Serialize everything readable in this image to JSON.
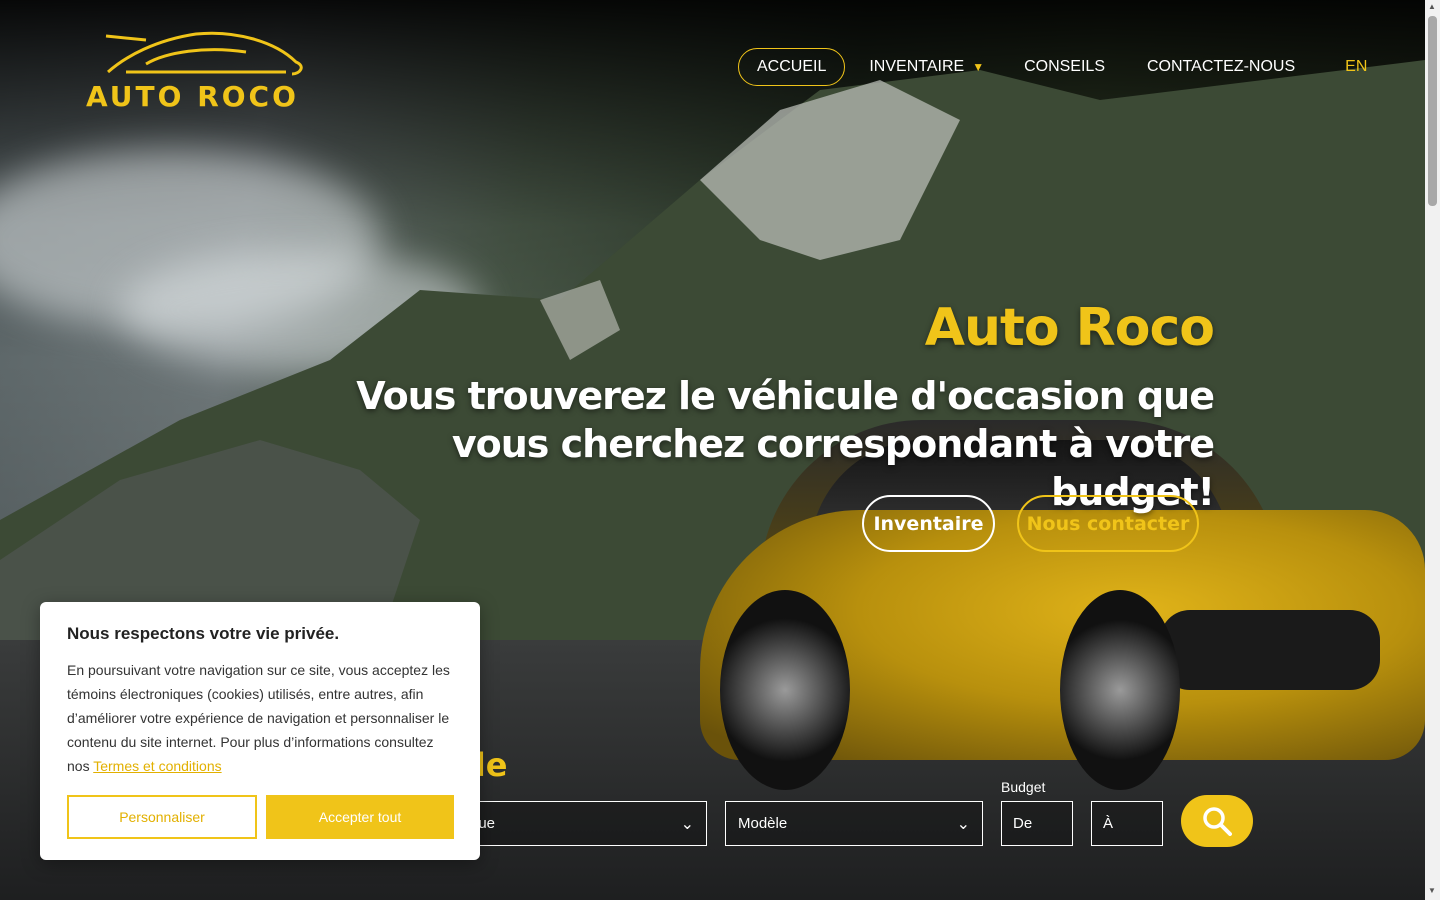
{
  "brand": {
    "name": "AUTO ROCO"
  },
  "nav": {
    "home": "ACCUEIL",
    "inventory": "INVENTAIRE",
    "tips": "CONSEILS",
    "contact": "CONTACTEZ-NOUS",
    "lang": "EN"
  },
  "hero": {
    "title": "Auto Roco",
    "subtitle_line1": "Vous trouverez le véhicule d'occasion que",
    "subtitle_line2": "vous cherchez correspondant à votre budget!",
    "btn_inventory": "Inventaire",
    "btn_contact": "Nous contacter"
  },
  "search": {
    "title_fragment": "ule",
    "make_placeholder": "rque",
    "model_placeholder": "Modèle",
    "budget_label": "Budget",
    "from_placeholder": "De",
    "to_placeholder": "À"
  },
  "cookie": {
    "title": "Nous respectons votre vie privée.",
    "text": "En poursuivant votre navigation sur ce site, vous acceptez les témoins électroniques (cookies) utilisés, entre autres, afin d’améliorer votre expérience de navigation et personnaliser le contenu du site internet. Pour plus d’informations consultez nos",
    "terms_link": "Termes et conditions",
    "customize": "Personnaliser",
    "accept": "Accepter tout"
  },
  "colors": {
    "accent": "#f0c419",
    "text": "#ffffff"
  },
  "icons": {
    "logo": "car-silhouette-icon",
    "chevron": "chevron-down-icon",
    "search": "search-icon"
  }
}
